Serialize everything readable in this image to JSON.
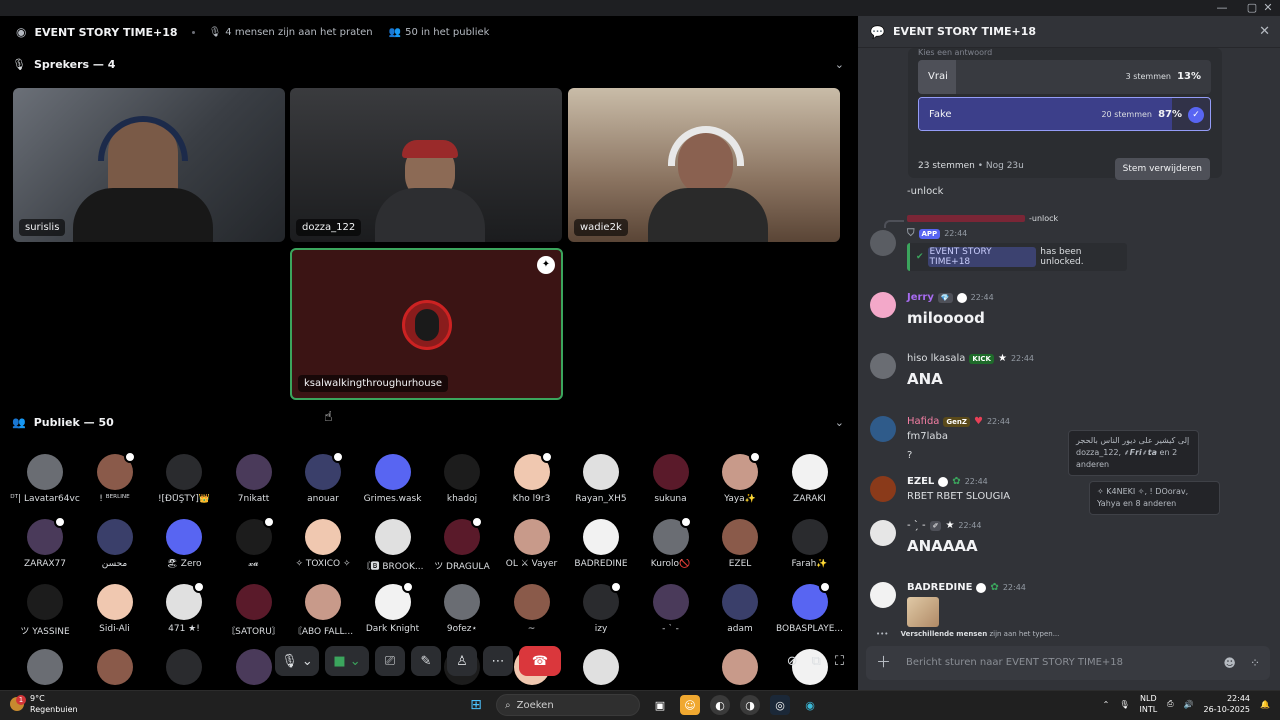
{
  "window": {
    "minimize_icon": "minimize-icon",
    "maximize_icon": "maximize-icon",
    "close_icon": "close-icon"
  },
  "stage": {
    "title": "EVENT STORY TIME+18",
    "talking": "4 mensen zijn aan het praten",
    "audience_count": "50 in het publiek",
    "speakers_label": "Sprekers — 4",
    "audience_label": "Publiek — 50",
    "speakers": [
      {
        "name": "surislis",
        "color": "#4a4f55"
      },
      {
        "name": "dozza_122",
        "color": "#2a2b2e"
      },
      {
        "name": "wadie2k",
        "color": "#8b7e6e"
      },
      {
        "name": "ksalwalkingthroughurhouse",
        "color": "#3b1414"
      }
    ],
    "audience": [
      [
        "ᴰᵀ| Lavatar64vc",
        "! ᴮᴱᴿᴸᴵᴺᴱ",
        "![ÐŮŞŤŸ]👑",
        "7nikatt",
        "anouar",
        "Grimes.wask",
        "khadoj",
        "Kho l9r3",
        "Rayan_XH5",
        "sukuna",
        "Yaya✨",
        "ZARAKI"
      ],
      [
        "ZARAX77",
        "محسن",
        "🏖 Zero",
        "𝔁𝓪",
        "✧ TOXICO ✧",
        "〘🅱 BROOK...",
        "ツ DRAGULA",
        "OL ⚔ Vayer",
        "BADREDINE",
        "Kurolo🚫",
        "EZEL",
        "Farah✨"
      ],
      [
        "ツ YASSINE",
        "Sidi-Ali",
        "471 ★!",
        "〘SATORU〙",
        "〘ABO FALL...",
        "Dark Knight",
        "9ofez⋆",
        "~",
        "izy",
        "- ˋ -",
        "adam",
        "BOBASPLAYE..."
      ]
    ]
  },
  "chat": {
    "title": "EVENT STORY TIME+18",
    "poll": {
      "hint": "Kies een antwoord",
      "options": [
        {
          "label": "Vrai",
          "votes": "3 stemmen",
          "pct": "13%",
          "fraction": 0.13,
          "selected": false
        },
        {
          "label": "Fake",
          "votes": "20 stemmen",
          "pct": "87%",
          "fraction": 0.87,
          "selected": true
        }
      ],
      "total": "23 stemmen",
      "remaining": "Nog 23u",
      "remove_label": "Stem verwijderen"
    },
    "messages": {
      "unlock_text": "-unlock",
      "system_reply": "-unlock",
      "system_tag": "APP",
      "system_time": "22:44",
      "system_channel": "EVENT STORY TIME+18",
      "system_text": "has been unlocked.",
      "jerry_name": "Jerry",
      "jerry_time": "22:44",
      "jerry_text": "milooood",
      "hiso_name": "hiso lkasala",
      "hiso_tag": "KICK",
      "hiso_time": "22:44",
      "hiso_text": "ANA",
      "hafida_name": "Hafida",
      "hafida_tag": "GenZ",
      "hafida_time": "22:44",
      "hafida_text1": "fm7laba",
      "hafida_text2": "?",
      "ezel_name": "EZEL",
      "ezel_time": "22:44",
      "ezel_text": "RBET RBET SLOUGIA",
      "tilde_name": "- ˋ̗ -",
      "tilde_time": "22:44",
      "tilde_text": "ANAAAA",
      "badr_name": "BADREDINE",
      "badr_time": "22:44",
      "typing_bold": "Verschillende mensen",
      "typing_rest": "zijn aan het typen..."
    },
    "tooltips": {
      "t1_line1": "إلى كيشير على ديور الناس بالحجر",
      "t1_line2": "dozza_122, ⸙𝙁𝙧𝙞⸙𝙩𝙖 en 2",
      "t1_line3": "anderen",
      "t2_line1": "✧ K4NEKI ✧, ! DOorav,",
      "t2_line2": "Yahya en 8 anderen"
    },
    "composer_placeholder": "Bericht sturen naar EVENT STORY TIME+18"
  },
  "taskbar": {
    "temp": "9°C",
    "weather": "Regenbuien",
    "search": "Zoeken",
    "lang1": "NLD",
    "lang2": "INTL",
    "time": "22:44",
    "date": "26-10-2025"
  },
  "colors": {
    "accent": "#5865f2",
    "end_call": "#da373c",
    "chat_bg": "#313338",
    "stage_bg": "#000000"
  }
}
